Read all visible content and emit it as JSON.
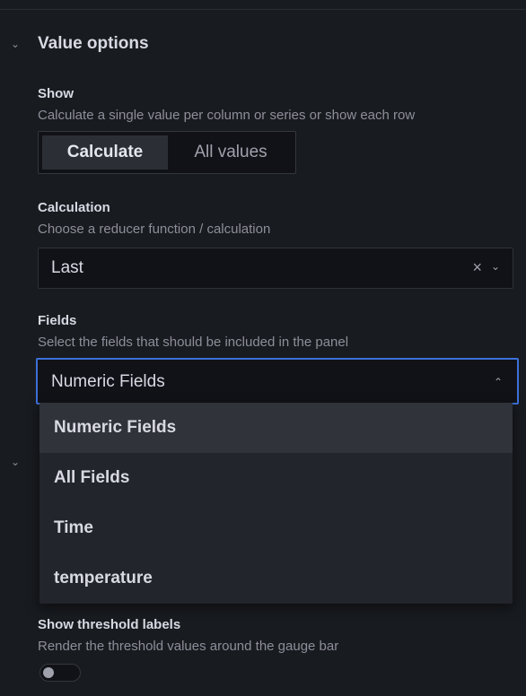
{
  "value_options": {
    "title": "Value options",
    "show": {
      "label": "Show",
      "description": "Calculate a single value per column or series or show each row",
      "options": [
        "Calculate",
        "All values"
      ],
      "selected": "Calculate"
    },
    "calculation": {
      "label": "Calculation",
      "description": "Choose a reducer function / calculation",
      "value": "Last",
      "clear_icon": "×",
      "caret_icon": "⌄"
    },
    "fields": {
      "label": "Fields",
      "description": "Select the fields that should be included in the panel",
      "value": "Numeric Fields",
      "caret_icon": "⌃",
      "options": [
        "Numeric Fields",
        "All Fields",
        "Time",
        "temperature"
      ]
    }
  },
  "chevron_icon": "⌄",
  "threshold": {
    "label": "Show threshold labels",
    "description": "Render the threshold values around the gauge bar",
    "toggle_on": false
  },
  "colors": {
    "background": "#181b1f",
    "input_bg": "#111217",
    "focus_border": "#3d71d9",
    "dropdown_bg": "#22252b"
  }
}
